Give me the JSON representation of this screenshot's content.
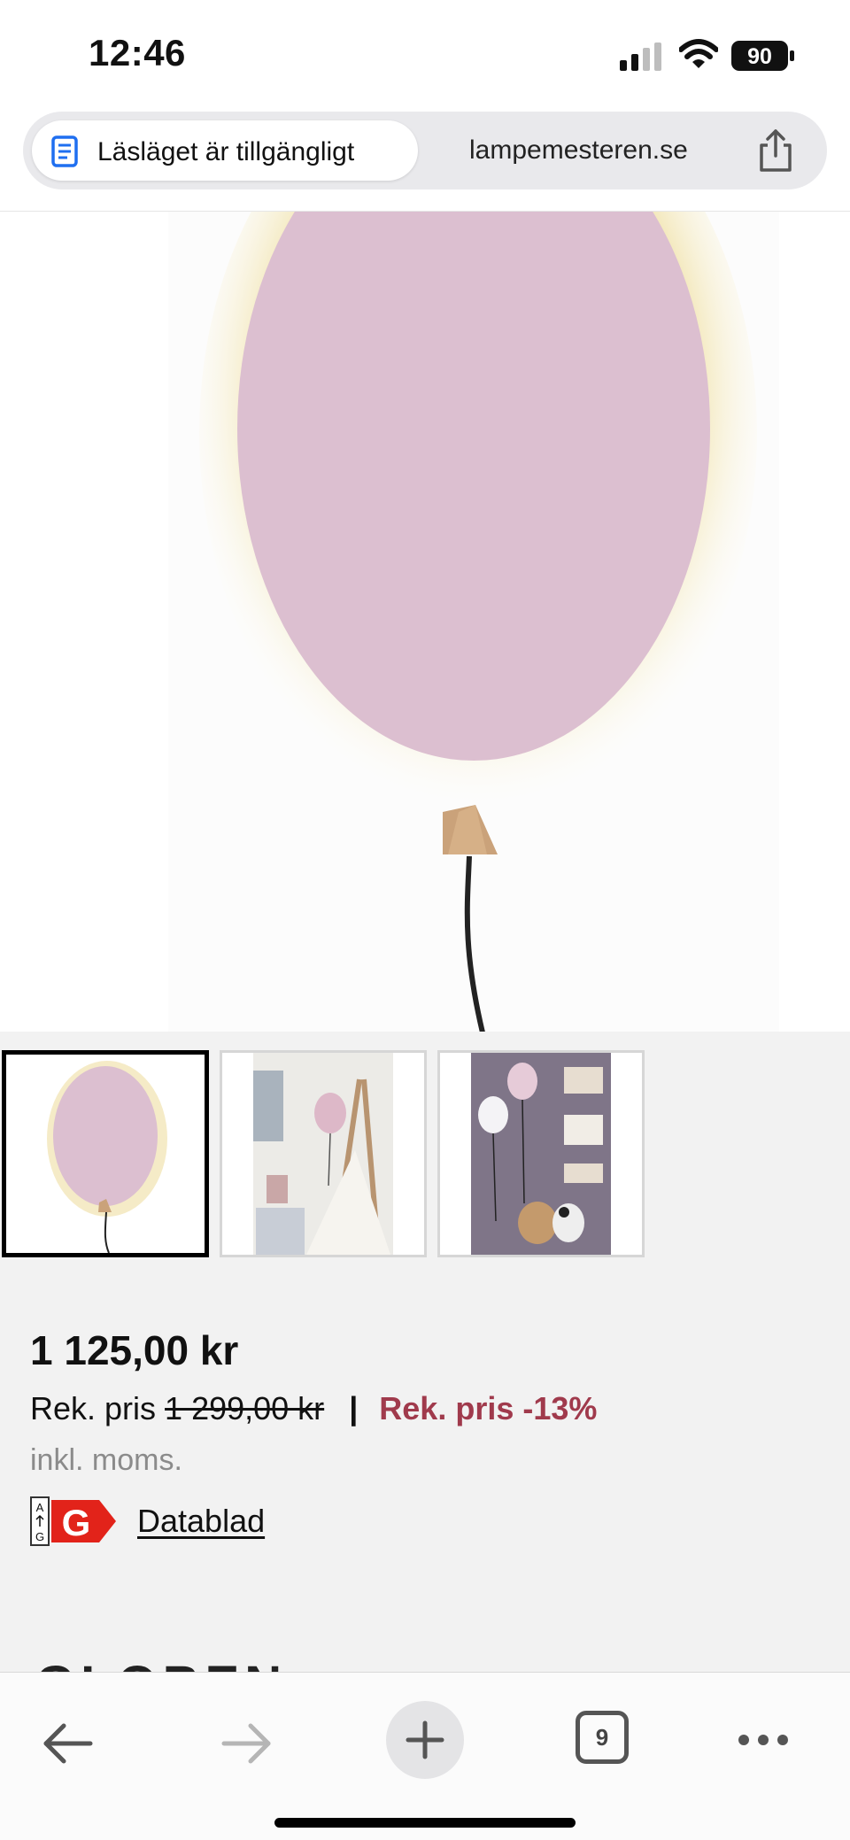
{
  "status_bar": {
    "time": "12:46",
    "battery": "90"
  },
  "url_bar": {
    "reader_label": "Läsläget är tillgängligt",
    "domain": "lampemesteren.se"
  },
  "product": {
    "price": "1 125,00 kr",
    "rek_label": "Rek. pris",
    "rek_old_price": "1 299,00 kr",
    "separator": "|",
    "rek_discount": "Rek. pris -13%",
    "vat_note": "inkl. moms.",
    "energy_class": "G",
    "energy_scale_top": "A",
    "energy_scale_bottom": "G",
    "datasheet_link": "Datablad"
  },
  "brand_peek": "GLOBEN LIGHTING",
  "toolbar": {
    "tab_count": "9"
  },
  "colors": {
    "balloon": "#dcbfd0",
    "discount": "#a03a4c",
    "energy_red": "#e2231a",
    "reader_blue": "#1f6ff0"
  },
  "icons": [
    "signal-icon",
    "wifi-icon",
    "battery-icon",
    "reader-mode-icon",
    "share-icon",
    "back-arrow-icon",
    "forward-arrow-icon",
    "plus-icon",
    "tabs-icon",
    "more-icon"
  ]
}
